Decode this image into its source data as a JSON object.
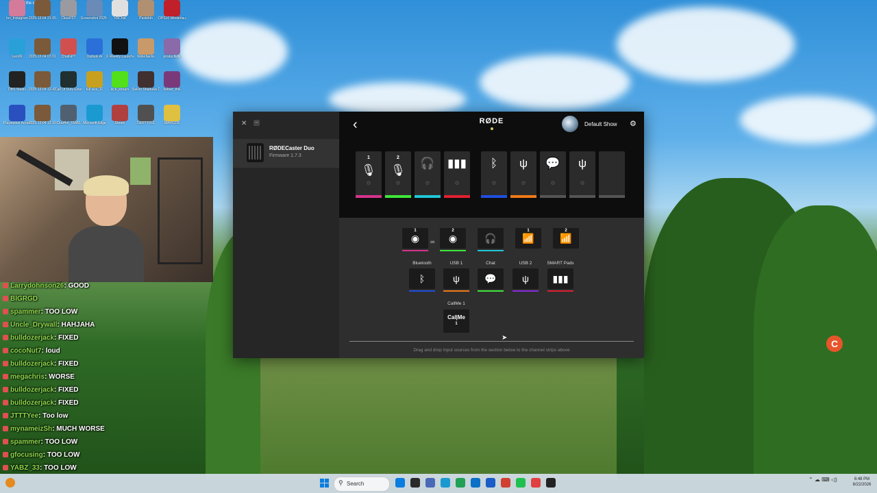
{
  "desktop": {
    "search_placeholder": "Search the web",
    "icons": [
      {
        "label": "Inc_Instagram",
        "color": "#d47a9a"
      },
      {
        "label": "2025-12-04 21-05-45",
        "color": "#7a5a3a"
      },
      {
        "label": "ClearFST",
        "color": "#9a9aa0"
      },
      {
        "label": "Screenshot 2025-12-04",
        "color": "#6a8ab8"
      },
      {
        "label": "VRChat",
        "color": "#e0e0e0"
      },
      {
        "label": "Pastebin",
        "color": "#b09070"
      },
      {
        "label": "OPS10 Winderlaunch",
        "color": "#c0202a"
      },
      {
        "label": "LeoVR",
        "color": "#2aa0d8"
      },
      {
        "label": "2025-12-04 07-51-23",
        "color": "#7a5a3a"
      },
      {
        "label": "ChatGPT",
        "color": "#d05050"
      },
      {
        "label": "Outlook AI",
        "color": "#2a70d8"
      },
      {
        "label": "X Weekly Launcher",
        "color": "#111111"
      },
      {
        "label": "folderbacks",
        "color": "#c89a6a"
      },
      {
        "label": "productivity",
        "color": "#8a6aa8"
      },
      {
        "label": "OBS Studio",
        "color": "#222222"
      },
      {
        "label": "2025-12-04 12-41-40",
        "color": "#7a5a3a"
      },
      {
        "label": "Call Of Duty Extension 13",
        "color": "#203030"
      },
      {
        "label": "full size_11",
        "color": "#c8a020"
      },
      {
        "label": "kick_stream",
        "color": "#52e01a"
      },
      {
        "label": "Sekiro Shadows Die",
        "color": "#403030"
      },
      {
        "label": "fallowr_this",
        "color": "#7a3a7a"
      },
      {
        "label": "Playstation Accessories",
        "color": "#2a50c0"
      },
      {
        "label": "2025-12-04 12-39-23",
        "color": "#7a5a3a"
      },
      {
        "label": "ClubHot_XMAS",
        "color": "#506070"
      },
      {
        "label": "Microsoft Edge",
        "color": "#1a9ad0"
      },
      {
        "label": "Steam",
        "color": "#b04040"
      },
      {
        "label": "DERT FIFE",
        "color": "#505050"
      },
      {
        "label": "MARGOS",
        "color": "#e0c040"
      }
    ]
  },
  "chat": [
    {
      "user": "Larrydohnson26",
      "msg": ": GOOD"
    },
    {
      "user": "BIGRGD",
      "msg": ""
    },
    {
      "user": "spammer",
      "msg": ": TOO LOW"
    },
    {
      "user": "Uncle_Drywall",
      "msg": ": HAHJAHA"
    },
    {
      "user": "bulldozerjack",
      "msg": ": FIXED"
    },
    {
      "user": "cocoNut7",
      "msg": ": loud"
    },
    {
      "user": "bulldozerjack",
      "msg": ": FIXED"
    },
    {
      "user": "megachris",
      "msg": ": WORSE"
    },
    {
      "user": "bulldozerjack",
      "msg": ": FIXED"
    },
    {
      "user": "bulldozerjack",
      "msg": ": FIXED"
    },
    {
      "user": "JTTTYee",
      "msg": ": Too low"
    },
    {
      "user": "mynameizSh",
      "msg": ": MUCH WORSE"
    },
    {
      "user": "spammer",
      "msg": ": TOO LOW"
    },
    {
      "user": "gfocusing",
      "msg": ": TOO LOW"
    },
    {
      "user": "YABZ_33",
      "msg": ": TOO LOW"
    }
  ],
  "app": {
    "brand": "RØDE",
    "show_name": "Default Show",
    "device_name": "RØDECaster Duo",
    "firmware": "Firmware 1.7.3",
    "strips": [
      {
        "icon": "mic-icon",
        "glyph": "🎙",
        "sub": "1",
        "color": "#d6338c"
      },
      {
        "icon": "mic-icon",
        "glyph": "🎙",
        "sub": "2",
        "color": "#3ee83a"
      },
      {
        "icon": "headphones-icon",
        "glyph": "🎧",
        "sub": "",
        "color": "#1fc8d8"
      },
      {
        "icon": "smart-pads-icon",
        "glyph": "▮▮▮",
        "sub": "",
        "color": "#e02030"
      },
      {
        "icon": "bluetooth-icon",
        "glyph": "ᛒ",
        "sub": "",
        "color": "#1f4fe0"
      },
      {
        "icon": "usb-1-icon",
        "glyph": "ψ",
        "sub": "1",
        "color": "#f07a18"
      },
      {
        "icon": "chat-icon",
        "glyph": "💬",
        "sub": "",
        "color": "#555555"
      },
      {
        "icon": "usb-2-icon",
        "glyph": "ψ",
        "sub": "2",
        "color": "#555555"
      },
      {
        "icon": "empty-slot",
        "glyph": "",
        "sub": "",
        "color": "#555555"
      }
    ],
    "inputs_top": [
      {
        "icon": "headset-mic-1-icon",
        "glyph": "◉",
        "num": "1",
        "color": "#d6338c"
      },
      {
        "icon": "headset-mic-2-icon",
        "glyph": "◉",
        "num": "2",
        "color": "#3ee83a"
      },
      {
        "icon": "headphone-icon",
        "glyph": "🎧",
        "num": "",
        "color": "#1fc8d8"
      },
      {
        "icon": "wireless-1-icon",
        "glyph": "📶",
        "num": "1",
        "color": ""
      },
      {
        "icon": "wireless-2-icon",
        "glyph": "📶",
        "num": "2",
        "color": ""
      }
    ],
    "link_glyph": "∞",
    "inputs_mid": [
      {
        "label": "Bluetooth",
        "icon": "bluetooth-icon",
        "glyph": "ᛒ",
        "color": "#1f4fe0"
      },
      {
        "label": "USB 1",
        "icon": "usb-1-icon",
        "glyph": "ψ",
        "color": "#f07a18"
      },
      {
        "label": "Chat",
        "icon": "chat-icon",
        "glyph": "💬",
        "color": "#3ee83a"
      },
      {
        "label": "USB 2",
        "icon": "usb-2-icon",
        "glyph": "ψ",
        "color": "#8b2be0"
      },
      {
        "label": "SMART Pads",
        "icon": "smart-pads-icon",
        "glyph": "▮▮▮",
        "color": "#e02030"
      }
    ],
    "callme_label": "CallMe 1",
    "callme_text": "Cal|Me",
    "callme_num": "1",
    "hint": "Drag and drop input sources from the section below to the channel strips above"
  },
  "taskbar": {
    "search_label": "Search",
    "clock_time": "6:48 PM",
    "clock_date": "8/22/2026",
    "apps": [
      "#0a7de0",
      "#2a2a2a",
      "#4a6ab8",
      "#1a9ad0",
      "#22a055",
      "#0a70c8",
      "#1a5cc8",
      "#d04030",
      "#20c050",
      "#e04040",
      "#222222"
    ]
  },
  "float_icon_glyph": "C"
}
